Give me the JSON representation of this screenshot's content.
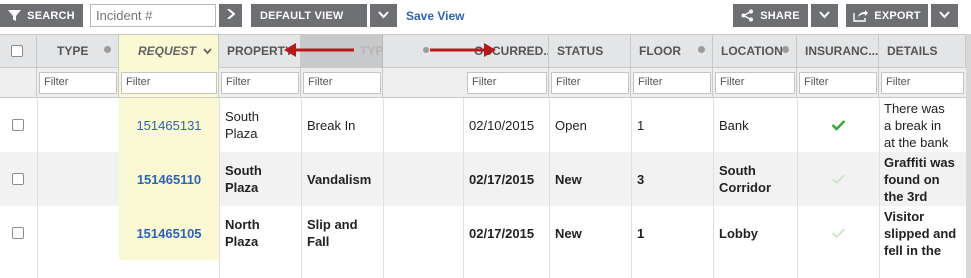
{
  "toolbar": {
    "search_label": "SEARCH",
    "search_icon": "filter-funnel-icon",
    "incident_placeholder": "Incident #",
    "go_icon": "chevron-right-icon",
    "view_label": "DEFAULT VIEW",
    "view_dropdown_icon": "chevron-down-icon",
    "save_view_label": "Save View",
    "share_label": "SHARE",
    "share_icon": "share-icon",
    "export_label": "EXPORT",
    "export_icon": "export-icon"
  },
  "columns": [
    {
      "key": "select",
      "label": ""
    },
    {
      "key": "type",
      "label": "TYPE"
    },
    {
      "key": "request",
      "label": "REQUEST"
    },
    {
      "key": "property",
      "label": "PROPERTY"
    },
    {
      "key": "type_label",
      "label": "TYPE LABEL"
    },
    {
      "key": "occurred",
      "label": "OCCURRED..."
    },
    {
      "key": "status",
      "label": "STATUS"
    },
    {
      "key": "floor",
      "label": "FLOOR"
    },
    {
      "key": "location",
      "label": "LOCATION"
    },
    {
      "key": "insurance",
      "label": "INSURANC..."
    },
    {
      "key": "details",
      "label": "DETAILS"
    }
  ],
  "filter_placeholder": "Filter",
  "drag_indicator": "column-resize-arrows",
  "rows": [
    {
      "request": "151465131",
      "property": [
        "South",
        "Plaza"
      ],
      "type_label": [
        "Break In"
      ],
      "occurred": "02/10/2015",
      "status": "Open",
      "floor": "1",
      "location": [
        "Bank"
      ],
      "insurance": "check-icon",
      "insurance_color": "#3aaa35",
      "details": [
        "There was",
        "a break in",
        "at the bank"
      ]
    },
    {
      "request": "151465110",
      "property": [
        "South",
        "Plaza"
      ],
      "type_label": [
        "Vandalism"
      ],
      "occurred": "02/17/2015",
      "status": "New",
      "floor": "3",
      "location": [
        "South",
        "Corridor"
      ],
      "insurance": "check-icon",
      "insurance_color": "#cfe8cc",
      "details": [
        "Graffiti was",
        "found on",
        "the 3rd"
      ]
    },
    {
      "request": "151465105",
      "property": [
        "North",
        "Plaza"
      ],
      "type_label": [
        "Slip and",
        "Fall"
      ],
      "occurred": "02/17/2015",
      "status": "New",
      "floor": "1",
      "location": [
        "Lobby"
      ],
      "insurance": "check-icon",
      "insurance_color": "#cfe8cc",
      "details": [
        "Visitor",
        "slipped and",
        "fell in the"
      ]
    }
  ]
}
